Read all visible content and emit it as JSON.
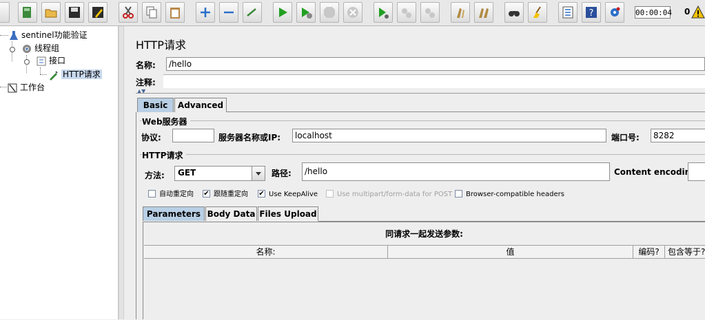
{
  "toolbar": {
    "buttons": [
      "new",
      "templates",
      "open",
      "save",
      "save-as",
      "cut",
      "copy",
      "paste",
      "expand",
      "collapse",
      "toggle",
      "start",
      "start-no-pause",
      "stop",
      "shutdown",
      "remote-start",
      "remote-stop",
      "remote-exit",
      "clear",
      "clear-all",
      "search",
      "reset-search",
      "function-helper",
      "help",
      "remote-options"
    ],
    "timer": "00:00:04",
    "error_count": "0"
  },
  "tree": {
    "root": "sentinel功能验证",
    "thread_group": "线程组",
    "controller": "接口",
    "sampler": "HTTP请求",
    "workbench": "工作台"
  },
  "sampler": {
    "title": "HTTP请求",
    "name_label": "名称:",
    "name_value": "/hello",
    "comment_label": "注释:",
    "comment_value": ""
  },
  "tabs": {
    "basic": "Basic",
    "advanced": "Advanced"
  },
  "web_server": {
    "group_title": "Web服务器",
    "protocol_label": "协议:",
    "protocol_value": "",
    "server_label": "服务器名称或IP:",
    "server_value": "localhost",
    "port_label": "端口号:",
    "port_value": "8282"
  },
  "http_request": {
    "group_title": "HTTP请求",
    "method_label": "方法:",
    "method_value": "GET",
    "path_label": "路径:",
    "path_value": "/hello",
    "encoding_label": "Content encoding:",
    "encoding_value": ""
  },
  "options": [
    {
      "label": "自动重定向",
      "checked": false,
      "disabled": false
    },
    {
      "label": "跟随重定向",
      "checked": true,
      "disabled": false
    },
    {
      "label": "Use KeepAlive",
      "checked": true,
      "disabled": false
    },
    {
      "label": "Use multipart/form-data for POST",
      "checked": false,
      "disabled": true
    },
    {
      "label": "Browser-compatible headers",
      "checked": false,
      "disabled": false
    }
  ],
  "sub_tabs": {
    "parameters": "Parameters",
    "body_data": "Body Data",
    "files_upload": "Files Upload"
  },
  "params": {
    "caption": "同请求一起发送参数:",
    "columns": [
      "名称:",
      "值",
      "编码?",
      "包含等于?"
    ]
  },
  "colors": {
    "active_tab": "#b8cfe5",
    "selected_node": "#c9d9ee"
  }
}
